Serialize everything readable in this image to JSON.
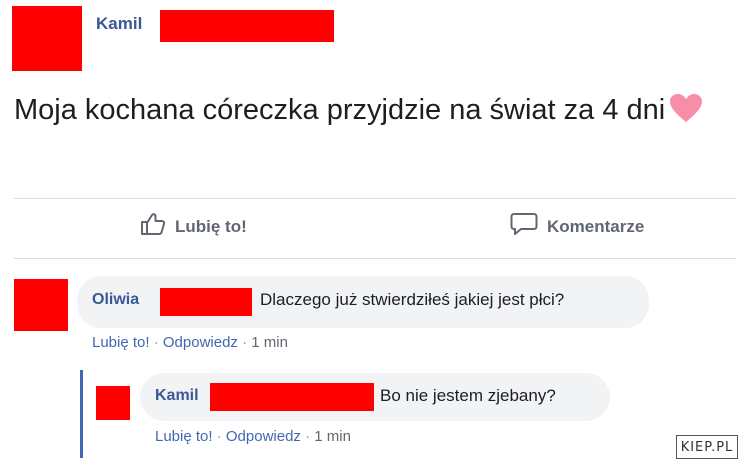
{
  "post": {
    "author": "Kamil",
    "text": "Moja kochana córeczka przyjdzie na świat za 4 dni",
    "emoji_icon": "heart-icon"
  },
  "actions": {
    "like_label": "Lubię to!",
    "comment_label": "Komentarze"
  },
  "comments": [
    {
      "author": "Oliwia",
      "text": "Dlaczego już stwierdziłeś jakiej jest płci?",
      "like": "Lubię to!",
      "reply": "Odpowiedz",
      "time": "1 min"
    }
  ],
  "reply": {
    "author": "Kamil",
    "text": "Bo nie jestem zjebany?",
    "like": "Lubię to!",
    "reply": "Odpowiedz",
    "time": "1 min"
  },
  "meta_separator": "·",
  "watermark": "KIEP.PL",
  "colors": {
    "link": "#385898",
    "redaction": "#ff0000",
    "bubble": "#f2f3f5",
    "heart": "#f78da7"
  }
}
